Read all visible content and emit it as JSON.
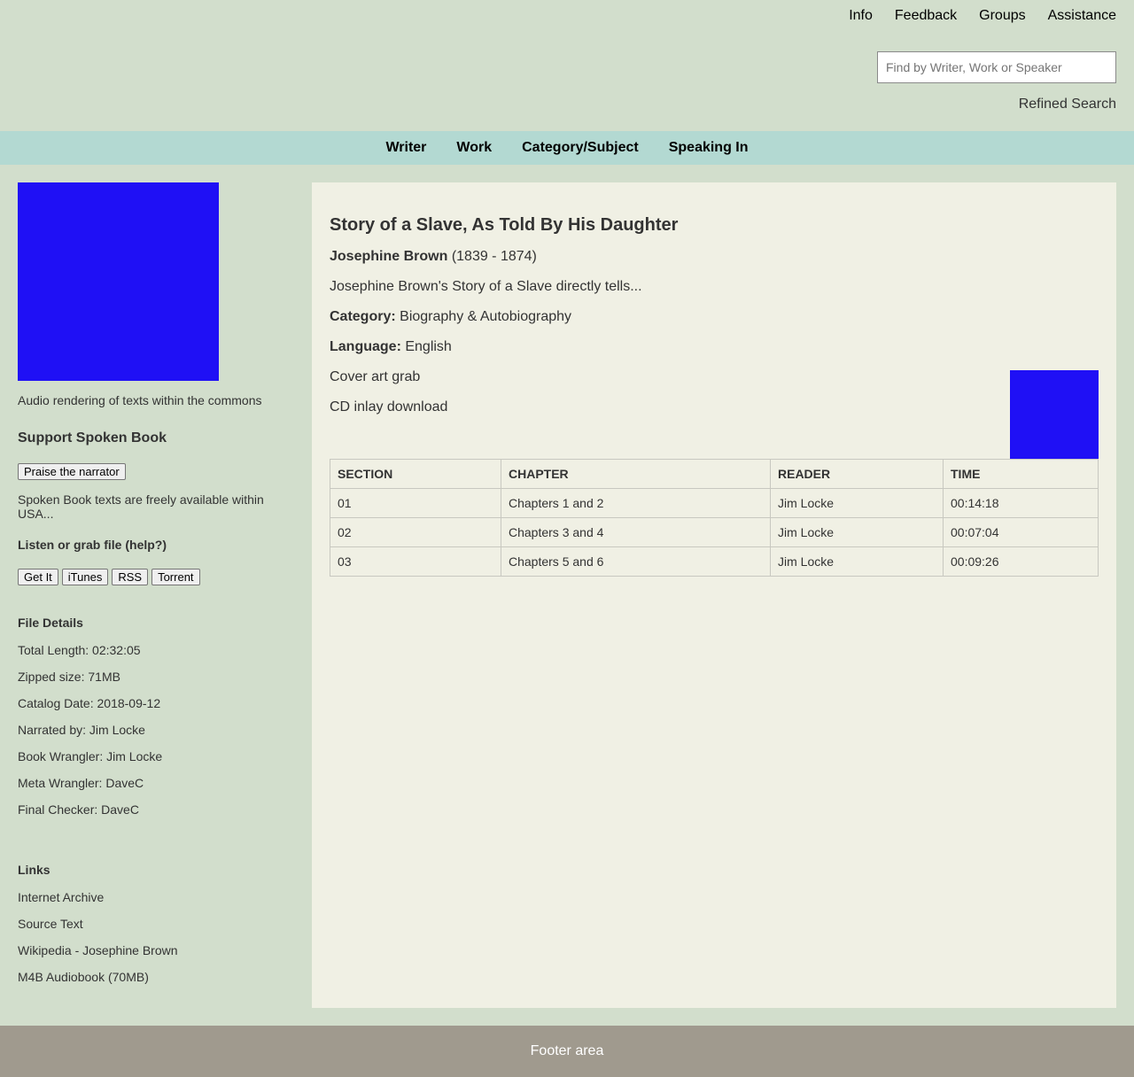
{
  "top_nav": [
    "Info",
    "Feedback",
    "Groups",
    "Assistance"
  ],
  "search": {
    "placeholder": "Find by Writer, Work or Speaker",
    "refined_label": "Refined Search"
  },
  "category_nav": [
    "Writer",
    "Work",
    "Category/Subject",
    "Speaking In"
  ],
  "sidebar": {
    "tagline": "Audio rendering of texts within the commons",
    "support_heading": "Support Spoken Book",
    "praise_button": "Praise the narrator",
    "free_text": "Spoken Book texts are freely available within USA...",
    "listen_heading": "Listen or grab file (help?)",
    "download_buttons": [
      "Get It",
      "iTunes",
      "RSS",
      "Torrent"
    ],
    "file_details_heading": "File Details",
    "file_details": [
      "Total Length: 02:32:05",
      "Zipped size: 71MB",
      "Catalog Date: 2018-09-12",
      "Narrated by: Jim Locke",
      "Book Wrangler: Jim Locke",
      "Meta Wrangler: DaveC",
      "Final Checker: DaveC"
    ],
    "links_heading": "Links",
    "links": [
      "Internet Archive",
      "Source Text",
      "Wikipedia - Josephine Brown",
      "M4B Audiobook (70MB)"
    ]
  },
  "book": {
    "title": "Story of a Slave, As Told By His Daughter",
    "author": "Josephine Brown",
    "author_years": "(1839 - 1874)",
    "summary": "Josephine Brown's Story of a Slave directly tells...",
    "category_label": "Category:",
    "category": "Biography & Autobiography",
    "language_label": "Language:",
    "language": "English",
    "cover_art_link": "Cover art grab",
    "cd_inlay_link": "CD inlay download"
  },
  "sections_table": {
    "headers": [
      "SECTION",
      "CHAPTER",
      "READER",
      "TIME"
    ],
    "rows": [
      [
        "01",
        "Chapters 1 and 2",
        "Jim Locke",
        "00:14:18"
      ],
      [
        "02",
        "Chapters 3 and 4",
        "Jim Locke",
        "00:07:04"
      ],
      [
        "03",
        "Chapters 5 and 6",
        "Jim Locke",
        "00:09:26"
      ]
    ]
  },
  "footer": "Footer area",
  "colors": {
    "background": "#d2decc",
    "navbar": "#b3d9d2",
    "panel": "#f0f0e4",
    "cover": "#1f10f5",
    "footer": "#a09a8e"
  }
}
